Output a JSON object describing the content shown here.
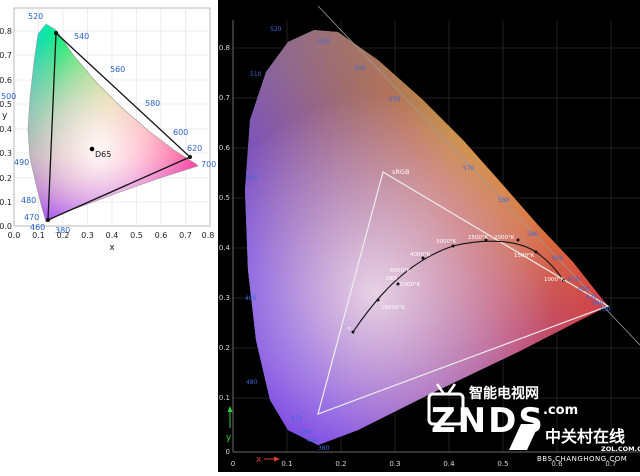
{
  "left": {
    "xlabel": "x",
    "ylabel": "y",
    "xticks": [
      "0.0",
      "0.1",
      "0.2",
      "0.3",
      "0.4",
      "0.5",
      "0.6",
      "0.7",
      "0.8"
    ],
    "yticks": [
      "0.0",
      "0.1",
      "0.2",
      "0.3",
      "0.4",
      "0.5",
      "0.6",
      "0.7",
      "0.8"
    ],
    "wavelengths": [
      "380",
      "460",
      "470",
      "480",
      "490",
      "500",
      "520",
      "540",
      "560",
      "580",
      "600",
      "620",
      "700"
    ],
    "whitepoint_label": "D65"
  },
  "right": {
    "xlabel": "x",
    "ylabel": "y",
    "xticks": [
      "0",
      "0.1",
      "0.2",
      "0.3",
      "0.4",
      "0.5",
      "0.6",
      "0.7"
    ],
    "yticks": [
      "0",
      "0.1",
      "0.2",
      "0.3",
      "0.4",
      "0.5",
      "0.6",
      "0.7",
      "0.8"
    ],
    "wavelengths": [
      "520",
      "530",
      "510",
      "540",
      "550",
      "500",
      "570",
      "580",
      "590",
      "600",
      "610",
      "620",
      "630",
      "640",
      "700",
      "480",
      "490",
      "470",
      "460",
      "450",
      "380"
    ],
    "standard_label": "sRGB",
    "cct_labels": [
      "3000°K",
      "2500°K",
      "2000°K",
      "4000°K",
      "1500°K",
      "6000°K",
      "5000°K",
      "1000°K",
      "10000°K",
      "D65",
      "∞"
    ]
  },
  "watermark": {
    "cn_brand": "智能电视网",
    "brand": "ZNDS",
    "brand_suffix": ".com",
    "zol_cn": "中关村在线",
    "zol_url": "ZOL.COM.CN",
    "zol_bbs": "BBS.CHANGHONG.COM"
  }
}
